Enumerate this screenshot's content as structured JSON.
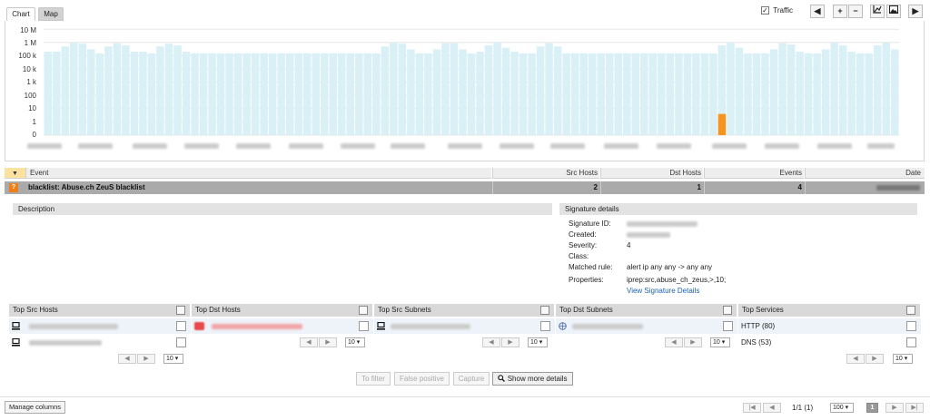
{
  "tabs": {
    "chart": "Chart",
    "map": "Map"
  },
  "toolbar": {
    "traffic_label": "Traffic"
  },
  "chart_data": {
    "type": "bar",
    "y_scale": "log",
    "y_ticks": [
      "10 M",
      "1 M",
      "100 k",
      "10 k",
      "1 k",
      "100",
      "10",
      "1",
      "0"
    ],
    "series": [
      {
        "values": [
          200000,
          200000,
          500000,
          1000000,
          800000,
          300000,
          150000,
          500000,
          900000,
          600000,
          200000,
          200000,
          150000,
          500000,
          800000,
          600000,
          200000,
          150000,
          150000,
          150000,
          150000,
          150000,
          150000,
          150000,
          150000,
          150000,
          150000,
          150000,
          150000,
          150000,
          150000,
          150000,
          150000,
          150000,
          150000,
          150000,
          150000,
          150000,
          150000,
          500000,
          1000000,
          800000,
          300000,
          150000,
          150000,
          300000,
          900000,
          900000,
          300000,
          150000,
          200000,
          600000,
          1000000,
          400000,
          200000,
          150000,
          150000,
          500000,
          900000,
          500000,
          150000,
          150000,
          150000,
          150000,
          150000,
          150000,
          150000,
          150000,
          150000,
          150000,
          150000,
          150000,
          150000,
          150000,
          150000,
          150000,
          150000,
          150000,
          600000,
          1000000,
          400000,
          150000,
          150000,
          150000,
          300000,
          900000,
          700000,
          200000,
          150000,
          150000,
          300000,
          1000000,
          600000,
          200000,
          150000,
          150000,
          600000,
          1000000,
          300000
        ]
      },
      {
        "values": [
          0,
          0,
          0,
          0,
          0,
          0,
          0,
          0,
          0,
          0,
          0,
          0,
          0,
          0,
          0,
          0,
          0,
          0,
          0,
          0,
          0,
          0,
          0,
          0,
          0,
          0,
          0,
          0,
          0,
          0,
          0,
          0,
          0,
          0,
          0,
          0,
          0,
          0,
          0,
          0,
          0,
          0,
          0,
          0,
          0,
          0,
          0,
          0,
          0,
          0,
          0,
          0,
          0,
          0,
          0,
          0,
          0,
          0,
          0,
          0,
          0,
          0,
          0,
          0,
          0,
          0,
          0,
          0,
          0,
          0,
          0,
          0,
          0,
          0,
          0,
          0,
          0,
          0,
          4,
          0,
          0,
          0,
          0,
          0,
          0,
          0,
          0,
          0,
          0,
          0,
          0,
          0,
          0,
          0,
          0,
          0,
          0,
          0,
          0
        ]
      }
    ],
    "colors": {
      "bar": "#daf0f7",
      "highlight": "#f7941d",
      "grid": "#e6e6e6"
    }
  },
  "events_table": {
    "columns": {
      "event": "Event",
      "src_hosts": "Src Hosts",
      "dst_hosts": "Dst Hosts",
      "events": "Events",
      "date": "Date"
    },
    "rows": [
      {
        "badge": "?",
        "event": "blacklist: Abuse.ch ZeuS blacklist",
        "src_hosts": "2",
        "dst_hosts": "1",
        "events": "4"
      }
    ]
  },
  "description": {
    "title": "Description"
  },
  "signature": {
    "title": "Signature details",
    "labels": {
      "id": "Signature ID:",
      "created": "Created:",
      "severity": "Severity:",
      "class": "Class:",
      "matched_rule": "Matched rule:",
      "properties": "Properties:"
    },
    "severity": "4",
    "matched_rule": "alert ip any any -> any any",
    "properties": "iprep:src,abuse_ch_zeus,>,10;",
    "view_link": "View Signature Details"
  },
  "panels": {
    "src_hosts": {
      "title": "Top Src Hosts",
      "page_size": "10 ▾"
    },
    "dst_hosts": {
      "title": "Top Dst Hosts",
      "page_size": "10 ▾"
    },
    "src_subnets": {
      "title": "Top Src Subnets",
      "page_size": "10 ▾"
    },
    "dst_subnets": {
      "title": "Top Dst Subnets",
      "page_size": "10 ▾"
    },
    "services": {
      "title": "Top Services",
      "items": [
        "HTTP (80)",
        "DNS (53)"
      ],
      "page_size": "10 ▾"
    }
  },
  "actions": {
    "to_filter": "To filter",
    "false_positive": "False positive",
    "capture": "Capture",
    "show_more": "Show more details"
  },
  "footer": {
    "manage_columns": "Manage columns",
    "page_info": "1/1 (1)",
    "page_size": "100 ▾",
    "current_page": "1"
  }
}
